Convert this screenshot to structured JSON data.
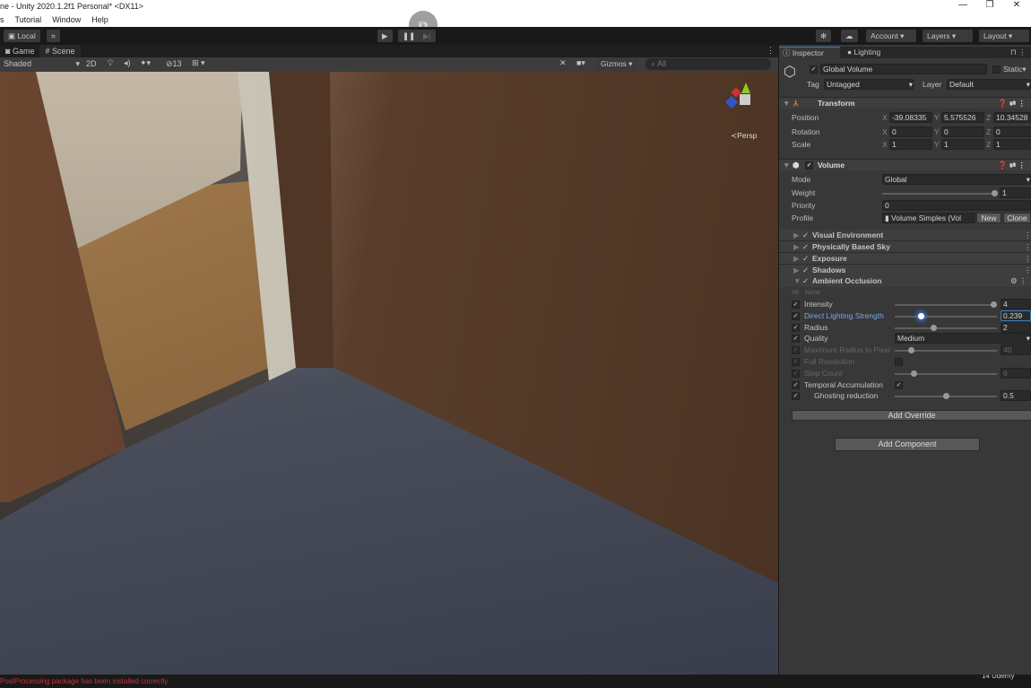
{
  "window": {
    "title": "ne - Unity 2020.1.2f1 Personal* <DX11>",
    "controls": [
      "—",
      "❐",
      "✕"
    ]
  },
  "menu": [
    "s",
    "Tutorial",
    "Window",
    "Help"
  ],
  "toolbar": {
    "local": "Local",
    "account": "Account",
    "layers": "Layers",
    "layout": "Layout"
  },
  "scene_tabs": {
    "game": "Game",
    "scene": "Scene"
  },
  "scene_toolbar": {
    "shading": "Shaded",
    "mode2d": "2D",
    "hidden_count": "13",
    "gizmos": "Gizmos",
    "search_placeholder": "All",
    "persp": "Persp"
  },
  "inspector": {
    "tabs": {
      "inspector": "Inspector",
      "lighting": "Lighting"
    },
    "object_name": "Global Volume",
    "static": "Static",
    "tag_label": "Tag",
    "tag": "Untagged",
    "layer_label": "Layer",
    "layer": "Default",
    "transform": {
      "title": "Transform",
      "position_label": "Position",
      "rotation_label": "Rotation",
      "scale_label": "Scale",
      "position": {
        "x": "-39.08335",
        "y": "5.575526",
        "z": "10.34528"
      },
      "rotation": {
        "x": "0",
        "y": "0",
        "z": "0"
      },
      "scale": {
        "x": "1",
        "y": "1",
        "z": "1"
      }
    },
    "volume": {
      "title": "Volume",
      "mode_label": "Mode",
      "mode": "Global",
      "weight_label": "Weight",
      "weight": "1",
      "weight_fraction": 1,
      "priority_label": "Priority",
      "priority": "0",
      "profile_label": "Profile",
      "profile": "Volume Simples (Vol",
      "new": "New",
      "clone": "Clone"
    },
    "overrides": [
      "Visual Environment",
      "Physically Based Sky",
      "Exposure",
      "Shadows"
    ],
    "ao": {
      "title": "Ambient Occlusion",
      "all": "All",
      "none": "None",
      "intensity_label": "Intensity",
      "intensity": "4",
      "dls_label": "Direct Lighting Strength",
      "dls": "0.239",
      "radius_label": "Radius",
      "radius": "2",
      "quality_label": "Quality",
      "quality": "Medium",
      "maxradius_label": "Maximum Radius In Pixel",
      "maxradius": "40",
      "fullres_label": "Full Resolution",
      "step_label": "Step Count",
      "step": "6",
      "temporal_label": "Temporal Accumulation",
      "ghost_label": "Ghosting reduction",
      "ghost": "0.5"
    },
    "add_override": "Add Override",
    "add_component": "Add Component"
  },
  "status": {
    "message": "PostProcessing package has been installed correctly.",
    "watermark": "Udemy"
  }
}
